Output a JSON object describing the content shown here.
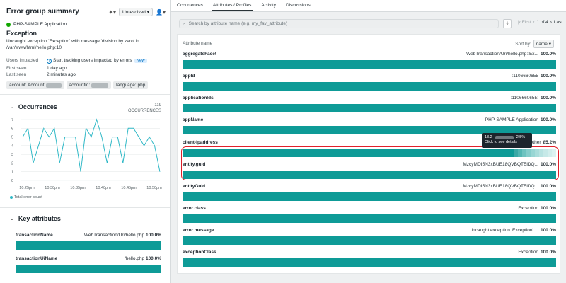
{
  "left_panel": {
    "title": "Error group summary",
    "status": "Unresolved",
    "entity_name": "PHP-SAMPLE Application",
    "exception_title": "Exception",
    "exception_message": "Uncaught exception 'Exception' with message 'division by zero' in /var/www/html/hello.php:10",
    "meta": {
      "users_impacted_label": "Users impacted",
      "users_impacted_value": "Start tracking users impacted by errors",
      "new_badge": "New",
      "first_seen_label": "First seen",
      "first_seen_value": "1 day ago",
      "last_seen_label": "Last seen",
      "last_seen_value": "2 minutes ago"
    },
    "tags": {
      "account": "account: Account",
      "accountid": "accountid:",
      "language": "language: php"
    },
    "occurrences": {
      "title": "Occurrences",
      "count": "119",
      "count_label": "OCCURRENCES",
      "legend": "Total error count"
    },
    "key_attributes": {
      "title": "Key attributes",
      "rows": [
        {
          "name": "transactionName",
          "value": "WebTransaction/Uri/hello.php",
          "pct": "100.0%"
        },
        {
          "name": "transactionUiName",
          "value": "/hello.php",
          "pct": "100.0%"
        }
      ]
    }
  },
  "chart_data": {
    "type": "line",
    "yticks": [
      "7",
      "6",
      "5",
      "4",
      "3",
      "2",
      "1",
      "0"
    ],
    "xticks": [
      "10:25pm",
      "10:30pm",
      "10:35pm",
      "10:40pm",
      "10:45pm",
      "10:50pm"
    ],
    "ylim": [
      0,
      7
    ],
    "series": [
      {
        "name": "Total error count",
        "color": "#2fb8c6",
        "values": [
          5,
          6,
          2,
          4,
          6,
          5,
          6,
          2,
          5,
          5,
          5,
          1,
          6,
          5,
          7,
          5,
          2,
          5,
          5,
          2,
          6,
          6,
          5,
          4,
          5,
          4,
          1
        ]
      }
    ]
  },
  "tabs": [
    "Occurrences",
    "Attributes / Profiles",
    "Activity",
    "Discussions"
  ],
  "search_placeholder": "Search by attribute name (e.g. my_fav_attribute)",
  "pager": {
    "first": "First",
    "text": "1 of 4",
    "last": "Last"
  },
  "table": {
    "header": "Attribute name",
    "sort_label": "Sort by:",
    "sort_value": "name",
    "rows": [
      {
        "name": "aggregateFacet",
        "value": "WebTransaction/Uri/hello.php::Ex...",
        "pct": "100.0%"
      },
      {
        "name": "appId",
        "value": ":1106660655",
        "pct": "100.0%"
      },
      {
        "name": "applicationIds",
        "value": ":1106660655:",
        "pct": "100.0%"
      },
      {
        "name": "appName",
        "value": "PHP-SAMPLE Application",
        "pct": "100.0%"
      },
      {
        "name": "client-ipaddress",
        "value": "Other",
        "pct": "85.2%"
      },
      {
        "name": "entity.guid",
        "value": "MzcyMDI5N3xBUE18QVBQTElDQ...",
        "pct": "100.0%"
      },
      {
        "name": "entityGuid",
        "value": "MzcyMDI5N3xBUE18QVBQTElDQ...",
        "pct": "100.0%"
      },
      {
        "name": "error.class",
        "value": "Exception",
        "pct": "100.0%"
      },
      {
        "name": "error.message",
        "value": "Uncaught exception 'Exception' ...",
        "pct": "100.0%"
      },
      {
        "name": "exceptionClass",
        "value": "Exception",
        "pct": "100.0%"
      }
    ],
    "tooltip": {
      "ip_prefix": "13.2",
      "pct": "2.5%",
      "hint": "Click to see details"
    }
  },
  "colors": {
    "bar": "#0e9b97",
    "highlight": "#e0202b",
    "entity_dot": "#11a600"
  }
}
